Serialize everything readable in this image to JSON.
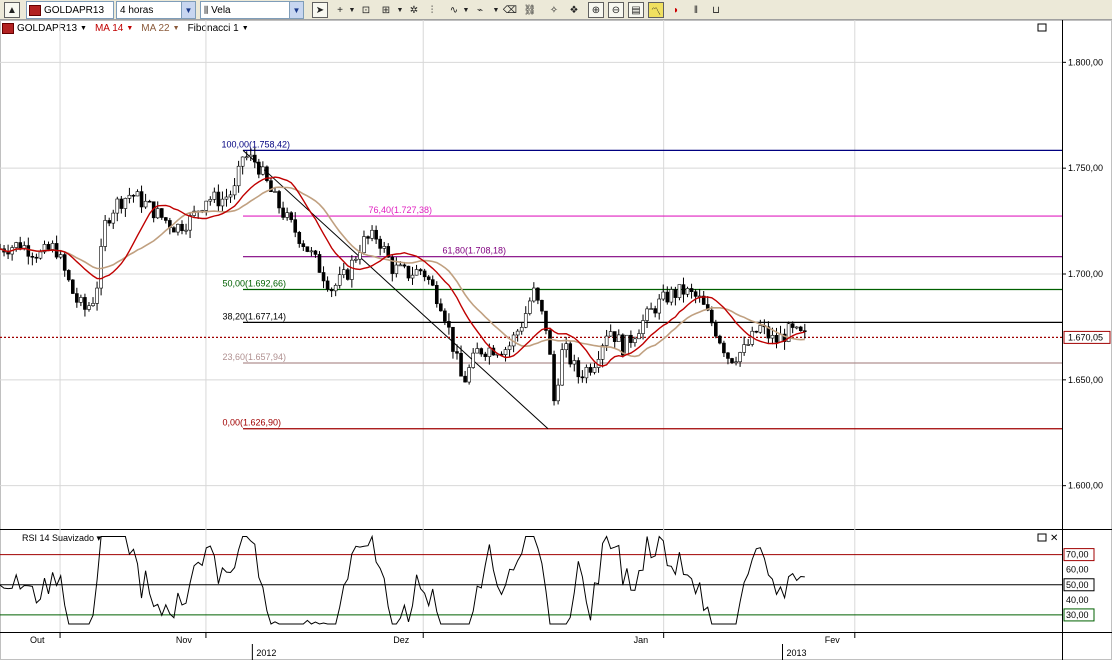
{
  "toolbar": {
    "symbol": "GOLDAPR13",
    "interval": "4 horas",
    "chart_style": "Vela"
  },
  "legend": {
    "symbol": "GOLDAPR13",
    "ma14": "MA 14",
    "ma22": "MA 22",
    "fibonacci": "Fibonacci 1"
  },
  "colors": {
    "price": "#000000",
    "ma14": "#c00000",
    "ma22": "#c0a080",
    "fib_100": "#000080",
    "fib_764": "#e020c0",
    "fib_618": "#800080",
    "fib_500": "#006000",
    "fib_382": "#000000",
    "fib_236": "#b09090",
    "fib_000": "#a00000",
    "last_price": "#a00000"
  },
  "chart_data": [
    {
      "type": "candlestick",
      "title": "",
      "ylim": [
        1580,
        1820
      ],
      "y_ticks": [
        1600,
        1650,
        1700,
        1750,
        1800
      ],
      "y_tick_labels": [
        "1.600,00",
        "1.650,00",
        "1.700,00",
        "1.750,00",
        "1.800,00"
      ],
      "last_price": 1670.05,
      "last_price_label": "1.670,05",
      "x_labels": [
        {
          "label": "Out",
          "t": 0.01
        },
        {
          "label": "Nov",
          "t": 0.155
        },
        {
          "label": "Dez",
          "t": 0.371
        },
        {
          "label": "Jan",
          "t": 0.61
        },
        {
          "label": "Fev",
          "t": 0.8
        }
      ],
      "year_labels": [
        {
          "label": "2012",
          "t": 0.225
        },
        {
          "label": "2013",
          "t": 0.752
        }
      ],
      "fibonacci": [
        {
          "label": "100,00(1.758,42)",
          "value": 1758.42,
          "key": "fib_100"
        },
        {
          "label": "76,40(1.727,38)",
          "value": 1727.38,
          "key": "fib_764"
        },
        {
          "label": "61,80(1.708,18)",
          "value": 1708.18,
          "key": "fib_618"
        },
        {
          "label": "50,00(1.692,66)",
          "value": 1692.66,
          "key": "fib_500"
        },
        {
          "label": "38,20(1.677,14)",
          "value": 1677.14,
          "key": "fib_382"
        },
        {
          "label": "23,60(1.657,94)",
          "value": 1657.94,
          "key": "fib_236"
        },
        {
          "label": "0,00(1.626,90)",
          "value": 1626.9,
          "key": "fib_000"
        }
      ],
      "close_path": [
        [
          0.0,
          1712
        ],
        [
          0.02,
          1714
        ],
        [
          0.04,
          1709
        ],
        [
          0.055,
          1713
        ],
        [
          0.065,
          1700
        ],
        [
          0.075,
          1688
        ],
        [
          0.085,
          1683
        ],
        [
          0.095,
          1690
        ],
        [
          0.105,
          1725
        ],
        [
          0.115,
          1733
        ],
        [
          0.13,
          1738
        ],
        [
          0.145,
          1733
        ],
        [
          0.16,
          1727
        ],
        [
          0.175,
          1722
        ],
        [
          0.19,
          1726
        ],
        [
          0.205,
          1736
        ],
        [
          0.22,
          1735
        ],
        [
          0.235,
          1740
        ],
        [
          0.24,
          1756
        ],
        [
          0.255,
          1753
        ],
        [
          0.27,
          1738
        ],
        [
          0.285,
          1726
        ],
        [
          0.3,
          1716
        ],
        [
          0.315,
          1705
        ],
        [
          0.33,
          1693
        ],
        [
          0.345,
          1700
        ],
        [
          0.36,
          1715
        ],
        [
          0.375,
          1718
        ],
        [
          0.39,
          1703
        ],
        [
          0.405,
          1700
        ],
        [
          0.42,
          1702
        ],
        [
          0.44,
          1685
        ],
        [
          0.46,
          1648
        ],
        [
          0.475,
          1664
        ],
        [
          0.49,
          1665
        ],
        [
          0.505,
          1665
        ],
        [
          0.52,
          1678
        ],
        [
          0.53,
          1692
        ],
        [
          0.545,
          1672
        ],
        [
          0.55,
          1638
        ],
        [
          0.56,
          1666
        ],
        [
          0.575,
          1652
        ],
        [
          0.59,
          1658
        ],
        [
          0.605,
          1675
        ],
        [
          0.62,
          1665
        ],
        [
          0.635,
          1675
        ],
        [
          0.65,
          1684
        ],
        [
          0.665,
          1690
        ],
        [
          0.68,
          1692
        ],
        [
          0.695,
          1688
        ],
        [
          0.71,
          1675
        ],
        [
          0.725,
          1660
        ],
        [
          0.74,
          1664
        ],
        [
          0.755,
          1675
        ],
        [
          0.77,
          1668
        ],
        [
          0.785,
          1673
        ],
        [
          0.8,
          1670
        ]
      ],
      "rsi": {
        "label": "RSI 14 Suavizado",
        "ylim": [
          20,
          85
        ],
        "levels": [
          {
            "value": 70,
            "label": "70,00",
            "key": "fib_000"
          },
          {
            "value": 60,
            "label": "60,00",
            "key": "price"
          },
          {
            "value": 50,
            "label": "50,00",
            "key": "price"
          },
          {
            "value": 40,
            "label": "40,00",
            "key": "price"
          },
          {
            "value": 30,
            "label": "30,00",
            "key": "fib_500"
          }
        ]
      }
    }
  ]
}
